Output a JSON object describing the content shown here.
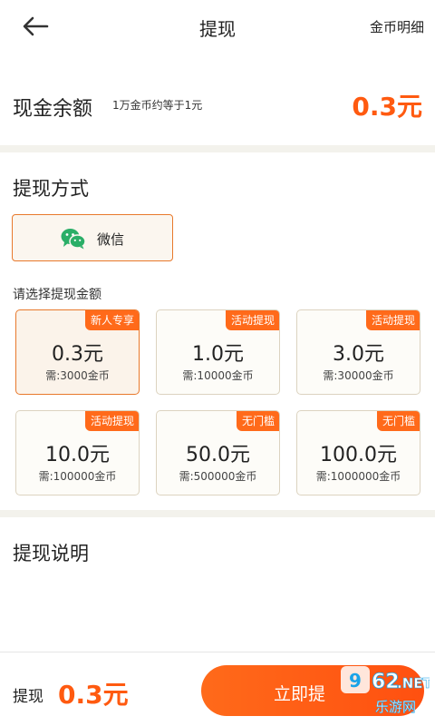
{
  "header": {
    "title": "提现",
    "link_label": "金币明细"
  },
  "balance": {
    "label": "现金余额",
    "note": "1万金币约等于1元",
    "value": "0.3元"
  },
  "method": {
    "title": "提现方式",
    "option_label": "微信"
  },
  "amounts": {
    "hint": "请选择提现金额",
    "cards": [
      {
        "amount": "0.3元",
        "need": "需:3000金币",
        "badge": "新人专享",
        "selected": true
      },
      {
        "amount": "1.0元",
        "need": "需:10000金币",
        "badge": "活动提现",
        "selected": false
      },
      {
        "amount": "3.0元",
        "need": "需:30000金币",
        "badge": "活动提现",
        "selected": false
      },
      {
        "amount": "10.0元",
        "need": "需:100000金币",
        "badge": "活动提现",
        "selected": false
      },
      {
        "amount": "50.0元",
        "need": "需:500000金币",
        "badge": "无门槛",
        "selected": false
      },
      {
        "amount": "100.0元",
        "need": "需:1000000金币",
        "badge": "无门槛",
        "selected": false
      }
    ]
  },
  "description": {
    "title": "提现说明"
  },
  "bottom": {
    "label": "提现",
    "value": "0.3元",
    "submit_label": "立即提"
  },
  "watermark": {
    "text": "962.NET",
    "sub": "乐游网"
  },
  "colors": {
    "accent": "#ff5a10",
    "wechat_green": "#2aae67",
    "divider": "#f3f2ec"
  }
}
